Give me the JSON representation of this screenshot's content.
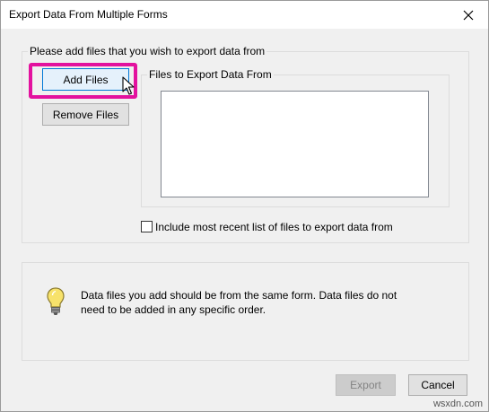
{
  "window": {
    "title": "Export Data From Multiple Forms",
    "close_glyph": "✕"
  },
  "file_group": {
    "legend": "Please add files that you wish to export data from",
    "add_label": "Add Files",
    "remove_label": "Remove Files",
    "list_legend": "Files to Export Data From",
    "files": [],
    "include_recent_label": "Include most recent list of files to export data from",
    "include_recent_checked": false
  },
  "info": {
    "icon": "lightbulb-icon",
    "text": "Data files you add should be from the same form. Data files do not need to be added in any specific order."
  },
  "footer": {
    "export_label": "Export",
    "cancel_label": "Cancel"
  },
  "watermark": "wsxdn.com",
  "colors": {
    "highlight": "#e3119e",
    "accent": "#0078d7",
    "bulb": "#f7e26b"
  }
}
